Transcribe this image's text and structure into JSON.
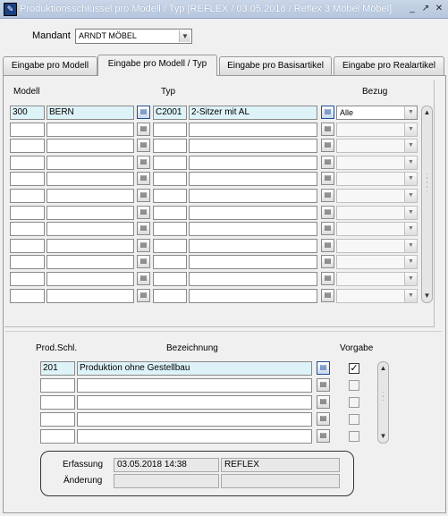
{
  "window": {
    "title": "Produktionsschlüssel pro Modell / Typ  [REFLEX / 03.05.2018 / Reflex 3 Möbel Möbel]",
    "app_icon": "form-app-icon",
    "controls": [
      "minimize",
      "restore",
      "close"
    ]
  },
  "mandant": {
    "label": "Mandant",
    "value": "ARNDT MÖBEL"
  },
  "tabs": [
    {
      "label": "Eingabe pro Modell",
      "active": false
    },
    {
      "label": "Eingabe pro Modell / Typ",
      "active": true
    },
    {
      "label": "Eingabe pro Basisartikel",
      "active": false
    },
    {
      "label": "Eingabe pro Realartikel",
      "active": false
    }
  ],
  "upper_grid": {
    "headers": {
      "modell": "Modell",
      "typ": "Typ",
      "bezug": "Bezug"
    },
    "rows": [
      {
        "modell_nr": "300",
        "modell_name": "BERN",
        "typ_nr": "C2001",
        "typ_name": "2-Sitzer mit AL",
        "bezug": "Alle"
      },
      {
        "modell_nr": "",
        "modell_name": "",
        "typ_nr": "",
        "typ_name": "",
        "bezug": ""
      },
      {
        "modell_nr": "",
        "modell_name": "",
        "typ_nr": "",
        "typ_name": "",
        "bezug": ""
      },
      {
        "modell_nr": "",
        "modell_name": "",
        "typ_nr": "",
        "typ_name": "",
        "bezug": ""
      },
      {
        "modell_nr": "",
        "modell_name": "",
        "typ_nr": "",
        "typ_name": "",
        "bezug": ""
      },
      {
        "modell_nr": "",
        "modell_name": "",
        "typ_nr": "",
        "typ_name": "",
        "bezug": ""
      },
      {
        "modell_nr": "",
        "modell_name": "",
        "typ_nr": "",
        "typ_name": "",
        "bezug": ""
      },
      {
        "modell_nr": "",
        "modell_name": "",
        "typ_nr": "",
        "typ_name": "",
        "bezug": ""
      },
      {
        "modell_nr": "",
        "modell_name": "",
        "typ_nr": "",
        "typ_name": "",
        "bezug": ""
      },
      {
        "modell_nr": "",
        "modell_name": "",
        "typ_nr": "",
        "typ_name": "",
        "bezug": ""
      },
      {
        "modell_nr": "",
        "modell_name": "",
        "typ_nr": "",
        "typ_name": "",
        "bezug": ""
      },
      {
        "modell_nr": "",
        "modell_name": "",
        "typ_nr": "",
        "typ_name": "",
        "bezug": ""
      }
    ]
  },
  "lower_grid": {
    "headers": {
      "prod_schl": "Prod.Schl.",
      "bezeichnung": "Bezeichnung",
      "vorgabe": "Vorgabe"
    },
    "rows": [
      {
        "prod_schl": "201",
        "bezeichnung": "Produktion ohne Gestellbau",
        "vorgabe": true
      },
      {
        "prod_schl": "",
        "bezeichnung": "",
        "vorgabe": false
      },
      {
        "prod_schl": "",
        "bezeichnung": "",
        "vorgabe": false
      },
      {
        "prod_schl": "",
        "bezeichnung": "",
        "vorgabe": false
      },
      {
        "prod_schl": "",
        "bezeichnung": "",
        "vorgabe": false
      }
    ]
  },
  "audit": {
    "erfassung_label": "Erfassung",
    "erfassung_datum": "03.05.2018 14:38",
    "erfassung_user": "REFLEX",
    "aenderung_label": "Änderung",
    "aenderung_datum": "",
    "aenderung_user": ""
  },
  "colors": {
    "selected_field_bg": "#ddf3f8",
    "titlebar_bg": "#c0cfe4"
  }
}
